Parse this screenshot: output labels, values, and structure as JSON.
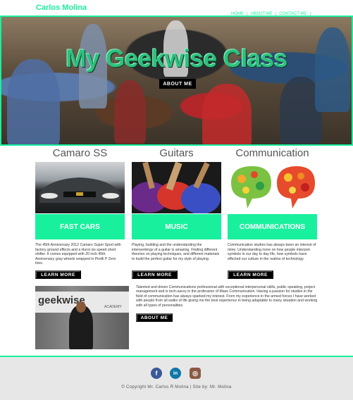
{
  "header": {
    "brand": "Carlos Molina",
    "nav": [
      {
        "label": "HOME"
      },
      {
        "label": "ABOUT ME"
      },
      {
        "label": "CONTACT ME"
      }
    ],
    "separator": "|"
  },
  "hero": {
    "title": "My Geekwise Class",
    "button": "ABOUT ME"
  },
  "columns": [
    {
      "title": "Camaro SS",
      "card_label": "FAST CARS",
      "text": "The 45th Anniversary 2012 Camaro Super Sport with factory ground effects and a Hurst six speed short shifter. It comes equipped with 20 inch 45th Anniversary gray wheels wrapped in Pirelli P Zero tires.",
      "button": "LEARN MORE"
    },
    {
      "title": "Guitars",
      "card_label": "MUSIC",
      "text": "Playing, building and the understanding the interworkings of a guitar is amazing. Finding different theories on playing techniques, and different materials to build the perfect guitar for my style of playing.",
      "button": "LEARN MORE"
    },
    {
      "title": "Communication",
      "card_label": "COMMUNICATIONS",
      "text": "Communication studies has always been an interest of mine. Understanding more on how people interpret symbols in our day to day life, how symbols have effected our culture in the realms of technology.",
      "button": "LEARN MORE"
    }
  ],
  "about": {
    "sign_text": "geekwise",
    "sign_sub": "ACADEMY",
    "text": "Talented and driven Communications professional with exceptional interpersonal skills, public speaking, project management and is tech-savvy in the profession of Mass Communication. Having a passion for studies in the field of communication has always sparked my interest. From my experience in the armed forces I have worked with people from all walks of life giving me the best experience in being adaptable to many situation and working with all types of personalities.",
    "button": "ABOUT ME"
  },
  "footer": {
    "social": [
      {
        "icon": "facebook-icon",
        "glyph": "f",
        "color": "#3b5998"
      },
      {
        "icon": "linkedin-icon",
        "glyph": "in",
        "color": "#0e76a8"
      },
      {
        "icon": "instagram-icon",
        "glyph": "◎",
        "color": "#8a5a44"
      }
    ],
    "copyright": "© Copyright  Mr.  Carlos  R Molina  |  Site by:  Mr.  Molina"
  },
  "colors": {
    "accent": "#19f09e",
    "button": "#000000"
  }
}
